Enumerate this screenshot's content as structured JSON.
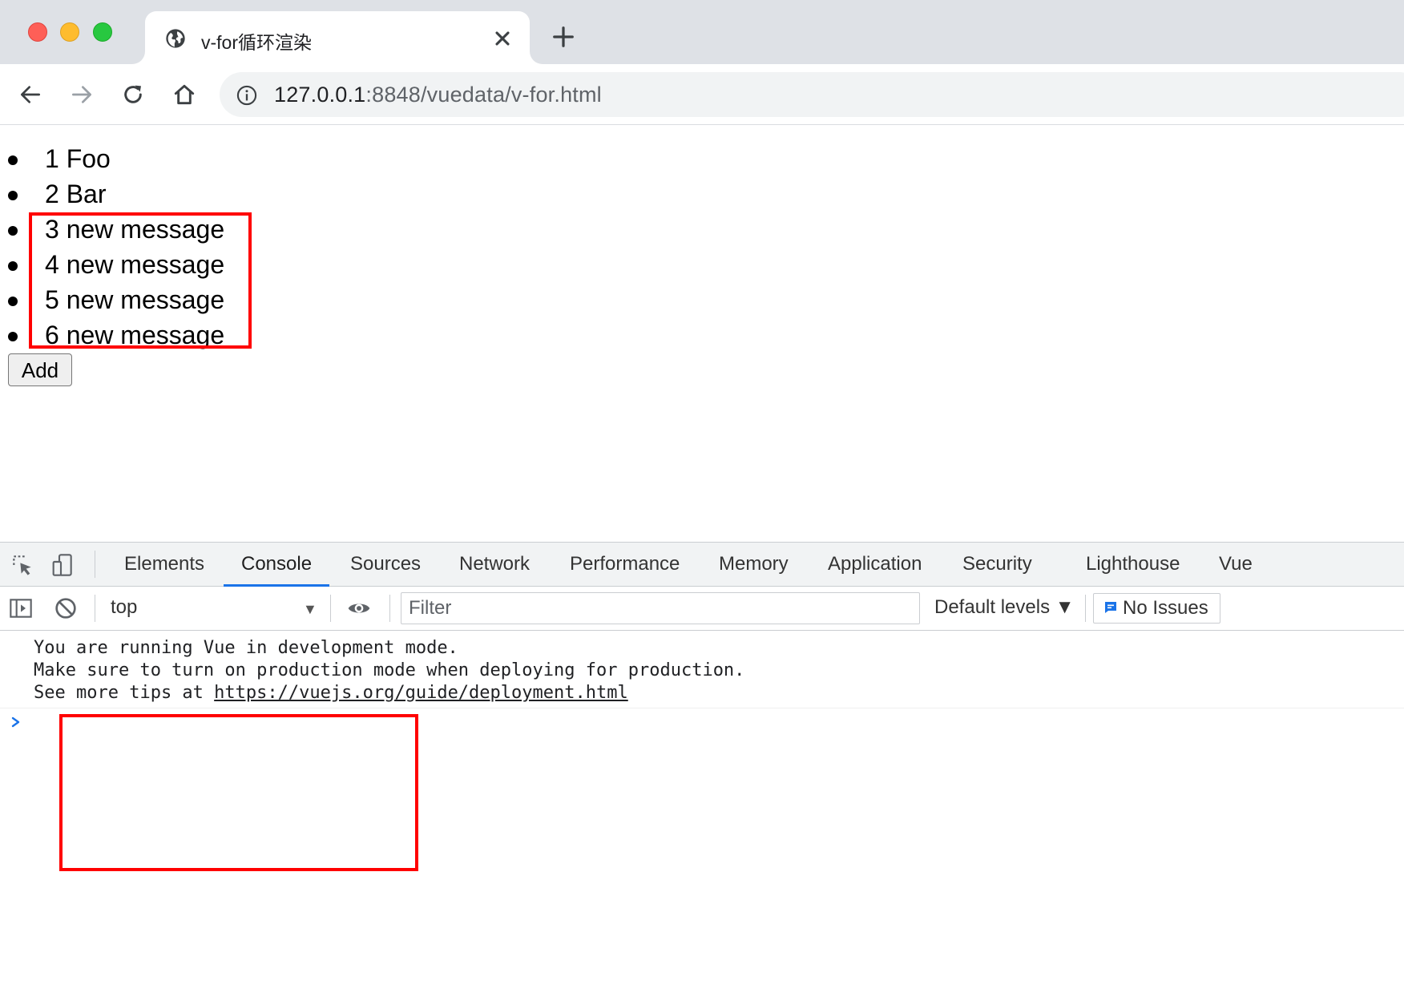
{
  "browser": {
    "tab_title": "v-for循环渲染",
    "url_host": "127.0.0.1",
    "url_rest": ":8848/vuedata/v-for.html"
  },
  "page": {
    "items": [
      {
        "text": "1 Foo"
      },
      {
        "text": "2 Bar"
      },
      {
        "text": "3 new message"
      },
      {
        "text": "4 new message"
      },
      {
        "text": "5 new message"
      },
      {
        "text": "6 new message"
      }
    ],
    "add_button_label": "Add",
    "highlight_color": "#ff0000"
  },
  "devtools": {
    "tabs": [
      {
        "label": "Elements"
      },
      {
        "label": "Console"
      },
      {
        "label": "Sources"
      },
      {
        "label": "Network"
      },
      {
        "label": "Performance"
      },
      {
        "label": "Memory"
      },
      {
        "label": "Application"
      },
      {
        "label": "Security"
      },
      {
        "label": "Lighthouse"
      },
      {
        "label": "Vue"
      }
    ],
    "active_tab": "Console",
    "context": "top",
    "filter_placeholder": "Filter",
    "levels_label": "Default levels ▼",
    "issues_label": "No Issues",
    "accent_color": "#1a73e8"
  },
  "console": {
    "line1": "You are running Vue in development mode.",
    "line2": "Make sure to turn on production mode when deploying for production.",
    "line3_prefix": "See more tips at ",
    "line3_link": "https://vuejs.org/guide/deployment.html"
  }
}
